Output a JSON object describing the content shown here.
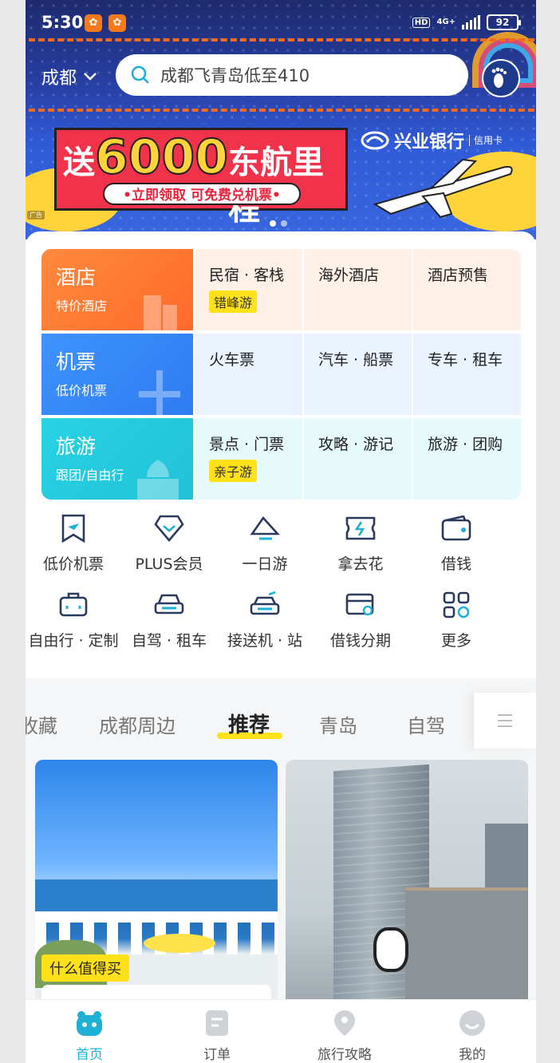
{
  "status": {
    "time": "5:30",
    "network": "4G+",
    "hd": "HD",
    "battery": "92"
  },
  "header": {
    "city": "成都",
    "search_placeholder": "成都飞青岛低至410"
  },
  "ad": {
    "promo_prefix": "送",
    "promo_number": "6000",
    "promo_suffix": "东航里程",
    "promo_sub": "•立即领取 可免费兑机票•",
    "bank_name": "兴业银行",
    "bank_card": "信用卡",
    "ad_tag": "广告"
  },
  "grid": {
    "rows": [
      {
        "title": "酒店",
        "subtitle": "特价酒店",
        "items": [
          {
            "label": "民宿 · 客栈",
            "tag": "错峰游"
          },
          {
            "label": "海外酒店"
          },
          {
            "label": "酒店预售"
          }
        ]
      },
      {
        "title": "机票",
        "subtitle": "低价机票",
        "items": [
          {
            "label": "火车票"
          },
          {
            "label": "汽车 · 船票"
          },
          {
            "label": "专车 · 租车"
          }
        ]
      },
      {
        "title": "旅游",
        "subtitle": "跟团/自由行",
        "items": [
          {
            "label": "景点 · 门票",
            "tag": "亲子游"
          },
          {
            "label": "攻略 · 游记"
          },
          {
            "label": "旅游 · 团购"
          }
        ]
      }
    ]
  },
  "quick": {
    "row1": [
      "低价机票",
      "PLUS会员",
      "一日游",
      "拿去花",
      "借钱"
    ],
    "row2": [
      "自由行 · 定制",
      "自驾 · 租车",
      "接送机 · 站",
      "借钱分期",
      "更多"
    ]
  },
  "tabs": [
    "收藏",
    "成都周边",
    "推荐",
    "青岛",
    "自驾"
  ],
  "feed": {
    "left_label": "什么值得买"
  },
  "bottom_nav": [
    "首页",
    "订单",
    "旅行攻略",
    "我的"
  ],
  "colors": {
    "accent": "#1fb0d6",
    "highlight": "#ffe11a",
    "hotel": "#ff7a33",
    "flight": "#3488f7",
    "travel": "#25cbe0"
  }
}
